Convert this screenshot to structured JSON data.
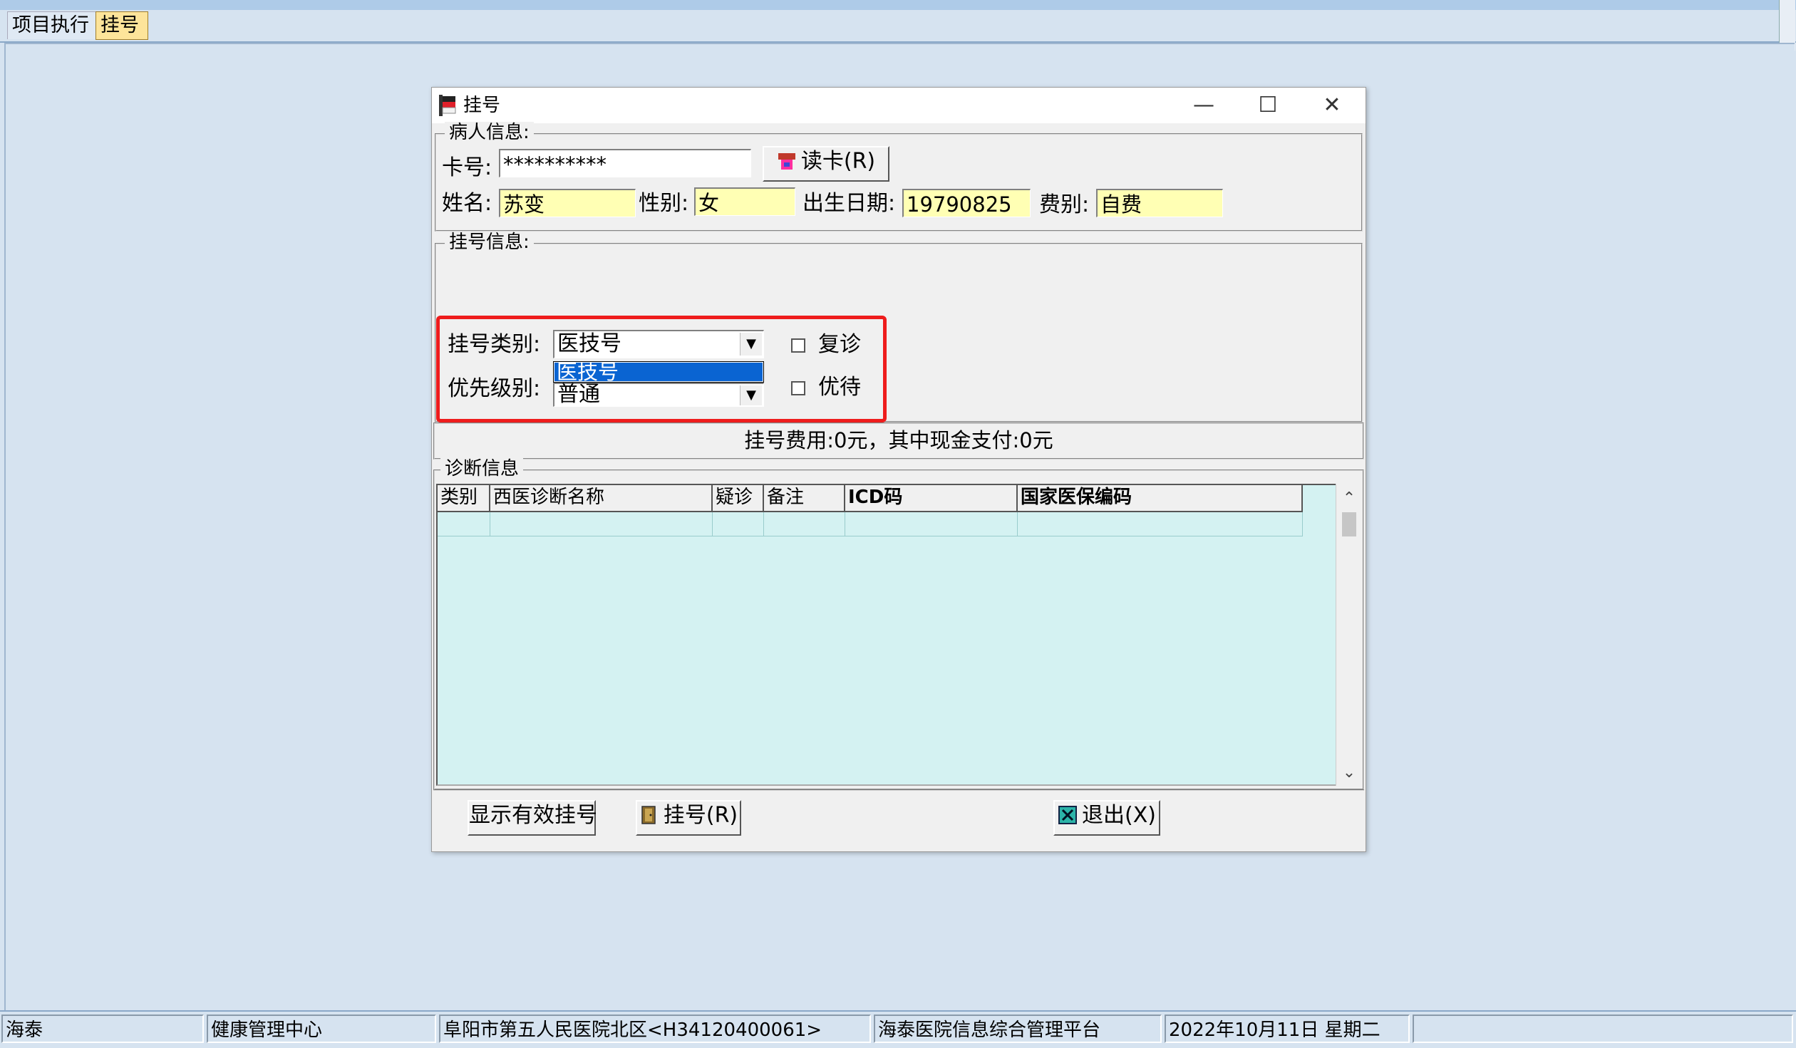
{
  "tabs": [
    {
      "label": "项目执行",
      "active": false
    },
    {
      "label": "挂号",
      "active": true
    }
  ],
  "dialog": {
    "title": "挂号",
    "window_controls": {
      "minimize": "—",
      "maximize": "☐",
      "close": "✕"
    },
    "patient_info": {
      "group_title": "病人信息:",
      "card_label": "卡号:",
      "card_value": "**********",
      "read_card_button": "读卡(R)",
      "name_label": "姓名:",
      "name_value": "苏变",
      "gender_label": "性别:",
      "gender_value": "女",
      "dob_label": "出生日期:",
      "dob_value": "19790825",
      "fee_type_label": "费别:",
      "fee_type_value": "自费"
    },
    "registration_info": {
      "group_title": "挂号信息:",
      "reg_type_label": "挂号类别:",
      "reg_type_value": "医技号",
      "reg_type_dropdown_item": "医技号",
      "priority_label": "优先级别:",
      "priority_value": "普通",
      "revisit_label": "复诊",
      "revisit_checked": false,
      "preferential_label": "优待",
      "preferential_checked": false,
      "highlight_color": "#ee1c1c"
    },
    "fee_summary": "挂号费用:0元，其中现金支付:0元",
    "diagnosis": {
      "group_title": "诊断信息",
      "columns": [
        "类别",
        "西医诊断名称",
        "疑诊",
        "备注",
        "ICD码",
        "国家医保编码"
      ],
      "rows": []
    },
    "buttons": {
      "show_valid": "显示有效挂号",
      "register": "挂号(R)",
      "exit": "退出(X)"
    }
  },
  "statusbar": {
    "items": [
      "海泰",
      "健康管理中心",
      "阜阳市第五人民医院北区<H34120400061>",
      "海泰医院信息综合管理平台",
      "2022年10月11日 星期二",
      ""
    ]
  },
  "colors": {
    "background": "#d6e3f0",
    "active_tab": "#fde49a",
    "yellow_field": "#ffffb4",
    "grid_background": "#d4f2f2",
    "selection": "#0a64d2"
  }
}
